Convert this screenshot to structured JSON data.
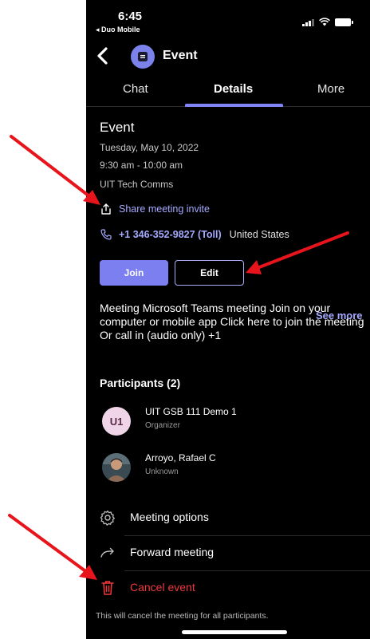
{
  "status_bar": {
    "time": "6:45",
    "back_app": "◂ Duo Mobile"
  },
  "header": {
    "title": "Event",
    "back_icon": "chevron-left-icon",
    "avatar_icon": "calendar-event-icon"
  },
  "tabs": [
    {
      "label": "Chat",
      "active": false
    },
    {
      "label": "Details",
      "active": true
    },
    {
      "label": "More",
      "active": false
    }
  ],
  "event": {
    "title": "Event",
    "date": "Tuesday, May 10, 2022",
    "time": "9:30 am - 10:00 am",
    "organizer_group": "UIT Tech Comms",
    "share_label": "Share meeting invite",
    "phone_number": "+1 346-352-9827 (Toll)",
    "phone_country": "United States"
  },
  "buttons": {
    "join": "Join",
    "edit": "Edit"
  },
  "description": {
    "text": "Meeting Microsoft Teams meeting Join on your computer or mobile app Click here to join the meeting Or call in (audio only) +1",
    "see_more": "See more"
  },
  "participants": {
    "title": "Participants (2)",
    "items": [
      {
        "name": "UIT GSB 111 Demo 1",
        "role": "Organizer",
        "initials": "U1"
      },
      {
        "name": "Arroyo, Rafael C",
        "role": "Unknown",
        "initials": ""
      }
    ]
  },
  "actions": [
    {
      "label": "Meeting options",
      "icon": "gear-icon"
    },
    {
      "label": "Forward meeting",
      "icon": "forward-arrow-icon"
    },
    {
      "label": "Cancel event",
      "icon": "trash-icon"
    }
  ],
  "cancel_note": "This will cancel the meeting for all participants.",
  "colors": {
    "background": "#000000",
    "accent": "#7b7ff0",
    "link": "#a6aaff",
    "danger": "#f0383d",
    "annotation": "#e8141c"
  }
}
